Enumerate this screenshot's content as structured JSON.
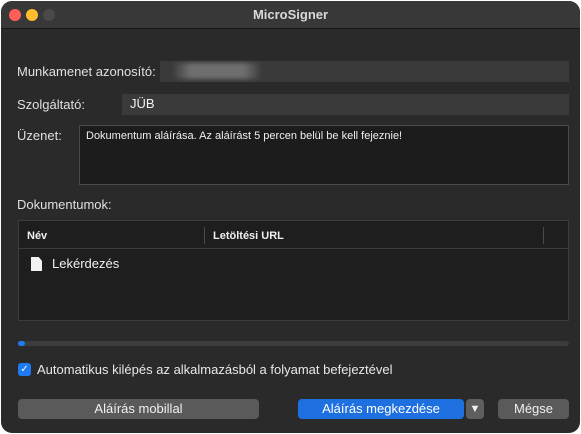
{
  "window": {
    "title": "MicroSigner"
  },
  "session": {
    "label": "Munkamenet azonosító:",
    "value": ""
  },
  "provider": {
    "label": "Szolgáltató:",
    "value": "JÜB"
  },
  "message": {
    "label": "Üzenet:",
    "value": "Dokumentum aláírása. Az aláírást 5 percen belül be kell fejeznie!"
  },
  "documents": {
    "label": "Dokumentumok:",
    "columns": [
      "Név",
      "Letöltési URL"
    ],
    "rows": [
      {
        "name": "Lekérdezés",
        "url": ""
      }
    ]
  },
  "progress": {
    "fraction": 0.01
  },
  "auto_exit": {
    "checked": true,
    "label": "Automatikus kilépés az alkalmazásból a folyamat befejeztével"
  },
  "buttons": {
    "mobile": "Aláírás mobillal",
    "start": "Aláírás megkezdése",
    "arrow": "▼",
    "cancel": "Mégse"
  },
  "colors": {
    "accent": "#1e7bf2",
    "window_bg": "#2a2a2a"
  }
}
